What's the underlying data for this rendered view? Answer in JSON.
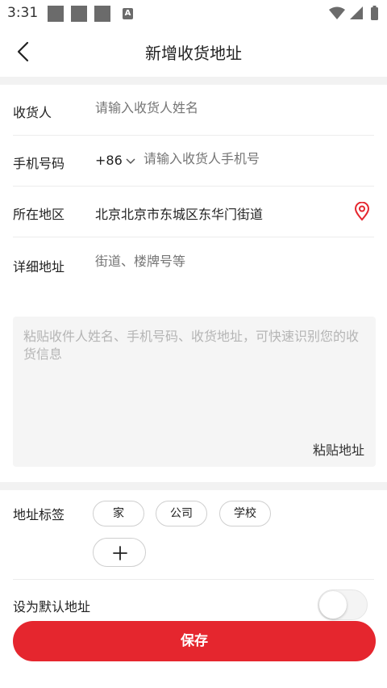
{
  "status_bar": {
    "time": "3:31",
    "icons": [
      "notification-square-icon",
      "notification-square-icon",
      "notification-square-icon",
      "a-icon",
      "wifi-icon",
      "signal-icon",
      "battery-icon"
    ]
  },
  "header": {
    "title": "新增收货地址",
    "back_icon": "chevron-left-icon"
  },
  "form": {
    "receiver": {
      "label": "收货人",
      "placeholder": "请输入收货人姓名"
    },
    "phone": {
      "label": "手机号码",
      "country_code": "+86",
      "placeholder": "请输入收货人手机号"
    },
    "region": {
      "label": "所在地区",
      "value": "北京北京市东城区东华门街道",
      "icon": "location-pin-icon"
    },
    "detail": {
      "label": "详细地址",
      "placeholder": "街道、楼牌号等"
    }
  },
  "paste": {
    "placeholder": "粘贴收件人姓名、手机号码、收货地址，可快速识别您的收货信息",
    "button_label": "粘贴地址"
  },
  "tags": {
    "label": "地址标签",
    "items": [
      "家",
      "公司",
      "学校"
    ],
    "add_icon": "plus-icon"
  },
  "default_address": {
    "label": "设为默认地址",
    "enabled": false
  },
  "save_button": {
    "label": "保存"
  },
  "colors": {
    "accent": "#e5262e",
    "placeholder": "#b5b5b5",
    "divider": "#ececec"
  }
}
